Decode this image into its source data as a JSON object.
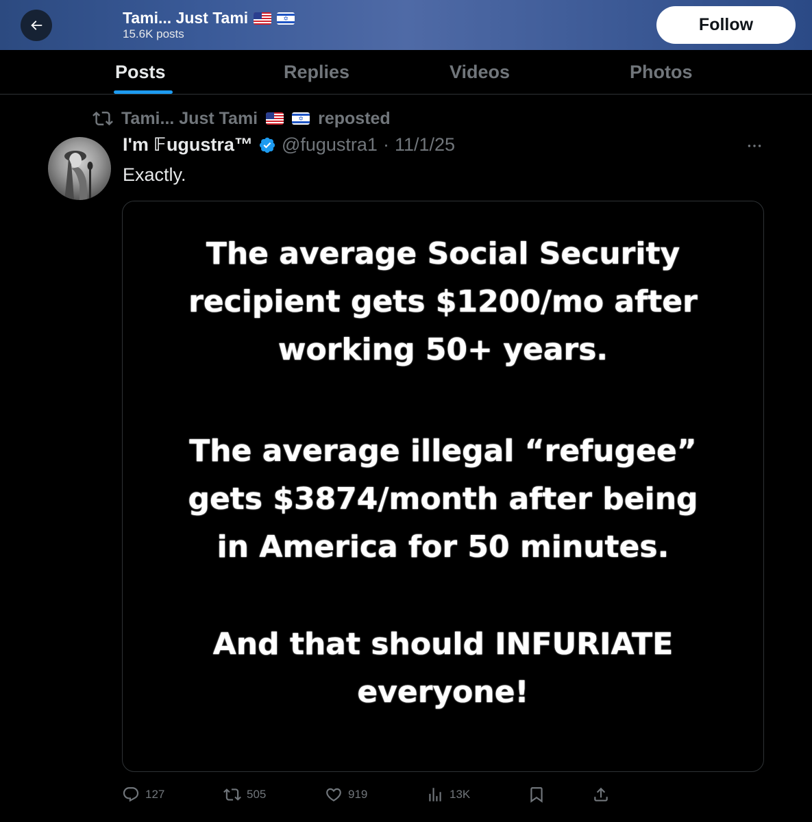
{
  "header": {
    "title": "Tami... Just Tami",
    "posts_count": "15.6K posts",
    "follow_label": "Follow"
  },
  "tabs": [
    {
      "label": "Posts",
      "active": true
    },
    {
      "label": "Replies",
      "active": false
    },
    {
      "label": "Videos",
      "active": false
    },
    {
      "label": "Photos",
      "active": false
    }
  ],
  "post": {
    "repost_by": "Tami... Just Tami",
    "repost_suffix": "reposted",
    "author_name": "I'm 𝔽ugustra™",
    "verified": true,
    "handle": "@fugustra1",
    "separator": "·",
    "date": "11/1/25",
    "text": "Exactly.",
    "media": {
      "paragraph_1": "The average Social Security\nrecipient gets $1200/mo after\nworking 50+ years.",
      "paragraph_2": "The average illegal “refugee”\ngets $3874/month after being\nin America for 50 minutes.",
      "paragraph_3": "And that should INFURIATE\neveryone!"
    },
    "stats": {
      "replies": "127",
      "reposts": "505",
      "likes": "919",
      "views": "13K"
    }
  },
  "colors": {
    "accent": "#1d9bf0",
    "muted": "#71767b",
    "text": "#e7e9ea",
    "background": "#000000"
  },
  "icons": [
    "back-arrow-icon",
    "flag-us-icon",
    "flag-il-icon",
    "repost-icon",
    "verified-badge-icon",
    "more-icon",
    "reply-icon",
    "like-icon",
    "views-icon",
    "bookmark-icon",
    "share-icon"
  ]
}
